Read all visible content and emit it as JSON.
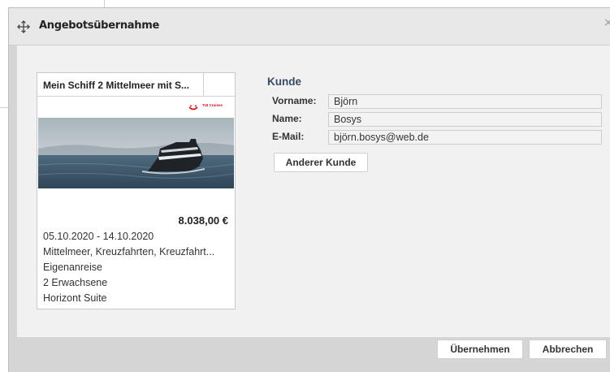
{
  "dialog": {
    "title": "Angebotsübernahme",
    "move_icon": "move-icon",
    "close_icon": "close-icon"
  },
  "offer": {
    "title": "Mein Schiff 2 Mittelmeer mit S...",
    "brand": "TUI Cruises",
    "image": "cruise-ship-photo",
    "price": "8.038,00 €",
    "dates": "05.10.2020 - 14.10.2020",
    "regions": "Mittelmeer, Kreuzfahrten, Kreuzfahrt...",
    "travel": "Eigenanreise",
    "travelers": "2 Erwachsene",
    "cabin": "Horizont Suite"
  },
  "customer": {
    "section_title": "Kunde",
    "firstname_label": "Vorname:",
    "firstname_value": "Björn",
    "lastname_label": "Name:",
    "lastname_value": "Bosys",
    "email_label": "E-Mail:",
    "email_value": "björn.bosys@web.de",
    "other_customer_label": "Anderer Kunde"
  },
  "footer": {
    "accept_label": "Übernehmen",
    "cancel_label": "Abbrechen"
  },
  "colors": {
    "section_title": "#3a4a63",
    "brand_red": "#d20a11",
    "content_bg": "#f1f1f1",
    "footer_bg": "#d5d5d5"
  }
}
